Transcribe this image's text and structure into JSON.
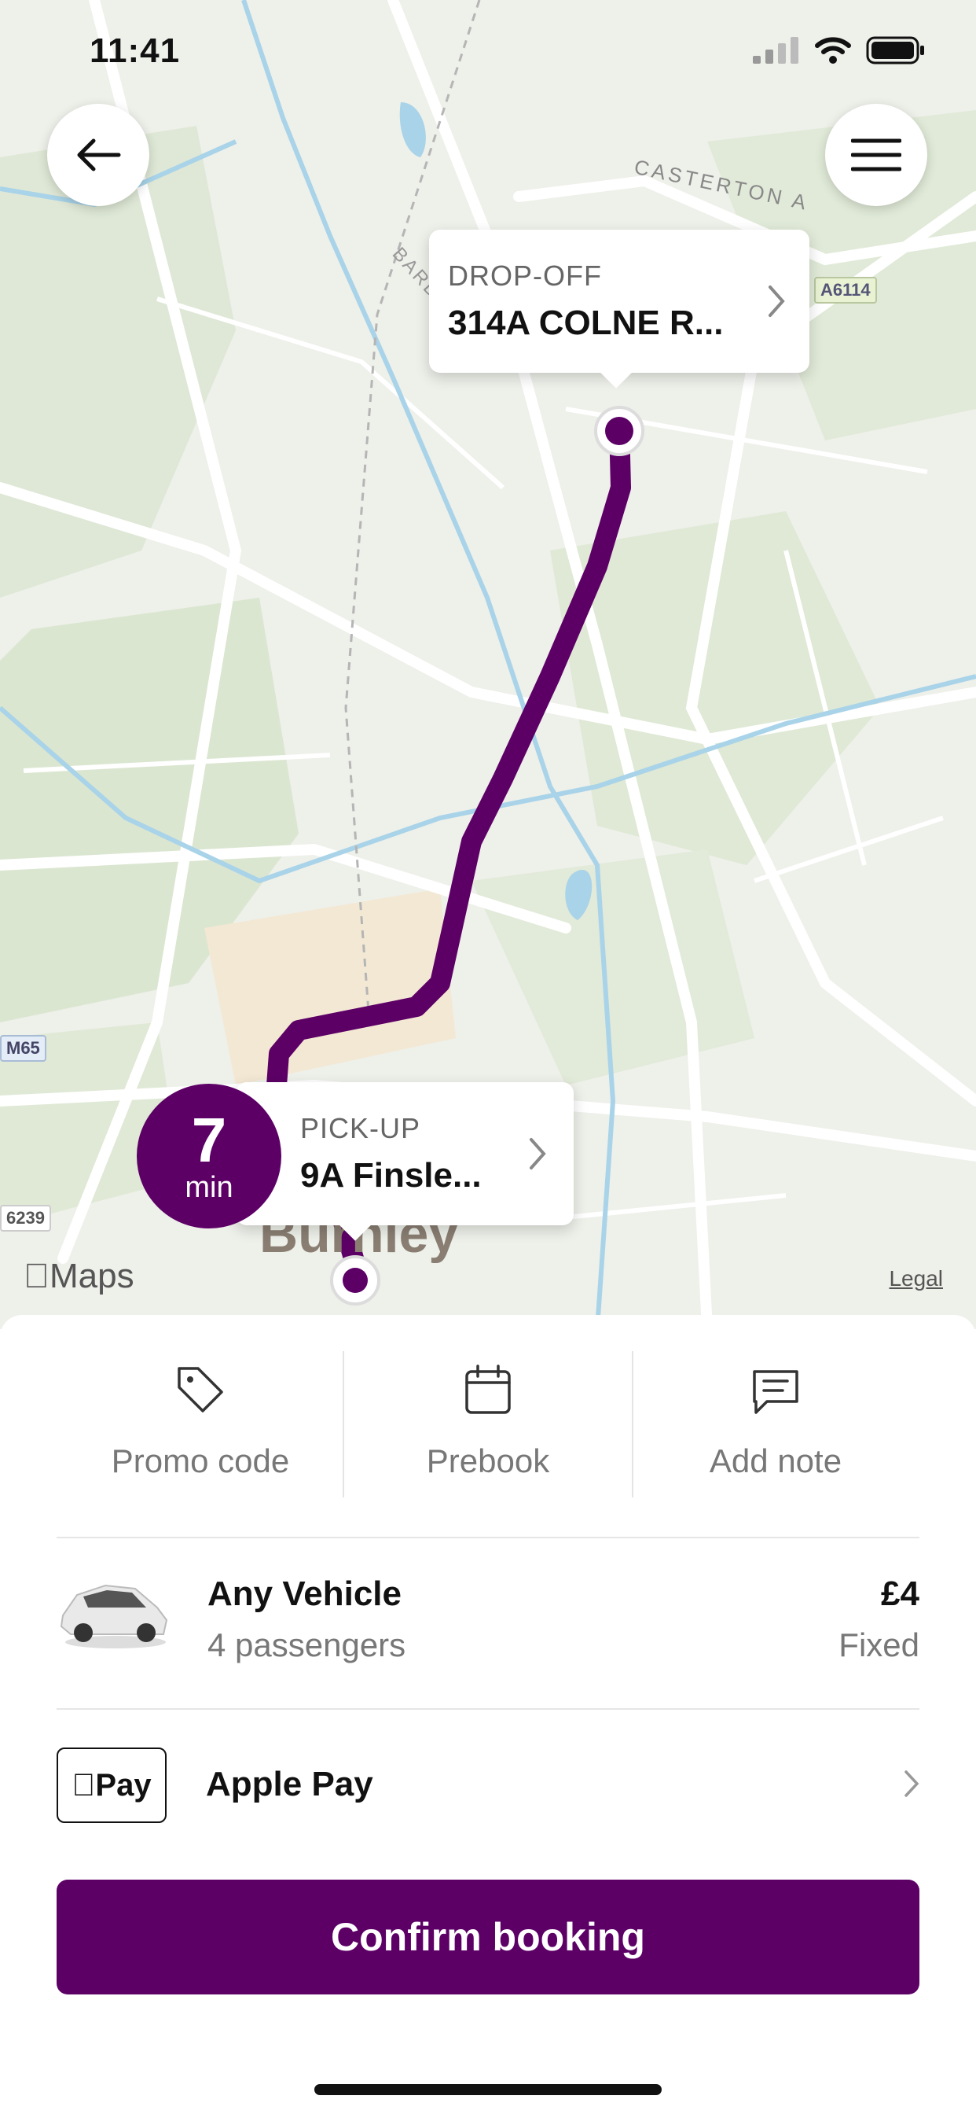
{
  "status_bar": {
    "time": "11:41"
  },
  "map": {
    "road_labels": [
      "CASTERTON A",
      "A6114",
      "BARDEN LANE",
      "M65",
      "6239"
    ],
    "town_label": "Burnley",
    "maps_brand": "Maps",
    "legal": "Legal",
    "route_color": "#5c0066"
  },
  "dropoff": {
    "kicker": "DROP-OFF",
    "address": "314A COLNE R..."
  },
  "pickup": {
    "kicker": "PICK-UP",
    "address": "9A Finsle...",
    "eta_value": "7",
    "eta_unit": "min"
  },
  "quick_actions": [
    {
      "label": "Promo code",
      "icon": "tag-icon"
    },
    {
      "label": "Prebook",
      "icon": "calendar-icon"
    },
    {
      "label": "Add note",
      "icon": "note-icon"
    }
  ],
  "vehicle": {
    "name": "Any Vehicle",
    "passengers": "4 passengers",
    "price": "£4",
    "price_type": "Fixed"
  },
  "payment": {
    "badge": "Pay",
    "label": "Apple Pay"
  },
  "confirm_label": "Confirm booking",
  "colors": {
    "accent": "#5c0066"
  }
}
